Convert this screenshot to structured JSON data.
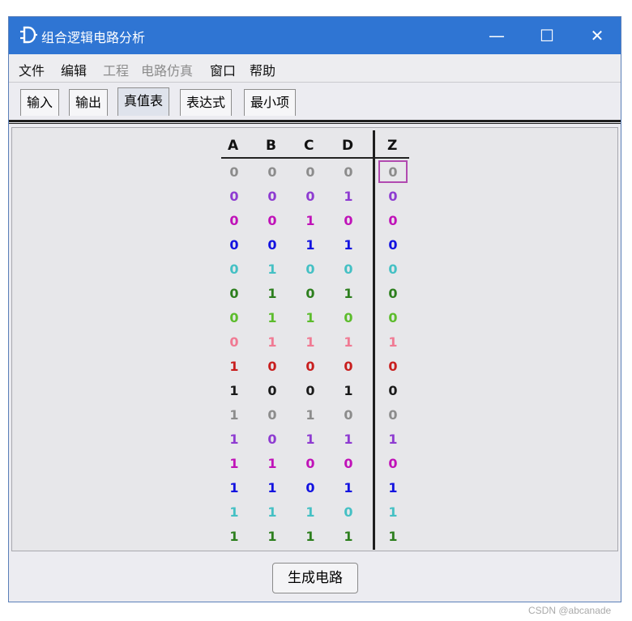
{
  "window": {
    "title": "组合逻辑电路分析",
    "controls": {
      "minimize": "—",
      "maximize": "☐",
      "close": "✕"
    },
    "app_icon": "logic-gate-icon"
  },
  "menu": [
    {
      "label": "文件",
      "enabled": true
    },
    {
      "label": "编辑",
      "enabled": true
    },
    {
      "label": "工程",
      "enabled": false
    },
    {
      "label": "电路仿真",
      "enabled": false
    },
    {
      "label": "窗口",
      "enabled": true
    },
    {
      "label": "帮助",
      "enabled": true
    }
  ],
  "tabs": [
    {
      "label": "输入",
      "active": false
    },
    {
      "label": "输出",
      "active": false
    },
    {
      "label": "真值表",
      "active": true
    },
    {
      "label": "表达式",
      "active": false
    },
    {
      "label": "最小项",
      "active": false
    }
  ],
  "truth_table": {
    "inputs": [
      "A",
      "B",
      "C",
      "D"
    ],
    "output": "Z",
    "selected_cell": {
      "row": 0,
      "column": "Z"
    },
    "rows": [
      {
        "values": [
          "0",
          "0",
          "0",
          "0",
          "0"
        ],
        "color": "#8c8c8c"
      },
      {
        "values": [
          "0",
          "0",
          "0",
          "1",
          "0"
        ],
        "color": "#8e3bd1"
      },
      {
        "values": [
          "0",
          "0",
          "1",
          "0",
          "0"
        ],
        "color": "#c012b8"
      },
      {
        "values": [
          "0",
          "0",
          "1",
          "1",
          "0"
        ],
        "color": "#1212e0"
      },
      {
        "values": [
          "0",
          "1",
          "0",
          "0",
          "0"
        ],
        "color": "#44c0c4"
      },
      {
        "values": [
          "0",
          "1",
          "0",
          "1",
          "0"
        ],
        "color": "#2d7f1e"
      },
      {
        "values": [
          "0",
          "1",
          "1",
          "0",
          "0"
        ],
        "color": "#5cbc2c"
      },
      {
        "values": [
          "0",
          "1",
          "1",
          "1",
          "1"
        ],
        "color": "#f07a93"
      },
      {
        "values": [
          "1",
          "0",
          "0",
          "0",
          "0"
        ],
        "color": "#c81e1e"
      },
      {
        "values": [
          "1",
          "0",
          "0",
          "1",
          "0"
        ],
        "color": "#1a1a1a"
      },
      {
        "values": [
          "1",
          "0",
          "1",
          "0",
          "0"
        ],
        "color": "#8c8c8c"
      },
      {
        "values": [
          "1",
          "0",
          "1",
          "1",
          "1"
        ],
        "color": "#8e3bd1"
      },
      {
        "values": [
          "1",
          "1",
          "0",
          "0",
          "0"
        ],
        "color": "#c012b8"
      },
      {
        "values": [
          "1",
          "1",
          "0",
          "1",
          "1"
        ],
        "color": "#1212e0"
      },
      {
        "values": [
          "1",
          "1",
          "1",
          "0",
          "1"
        ],
        "color": "#44c0c4"
      },
      {
        "values": [
          "1",
          "1",
          "1",
          "1",
          "1"
        ],
        "color": "#2d7f1e"
      }
    ]
  },
  "generate_button": "生成电路",
  "watermark": "CSDN @abcanade"
}
